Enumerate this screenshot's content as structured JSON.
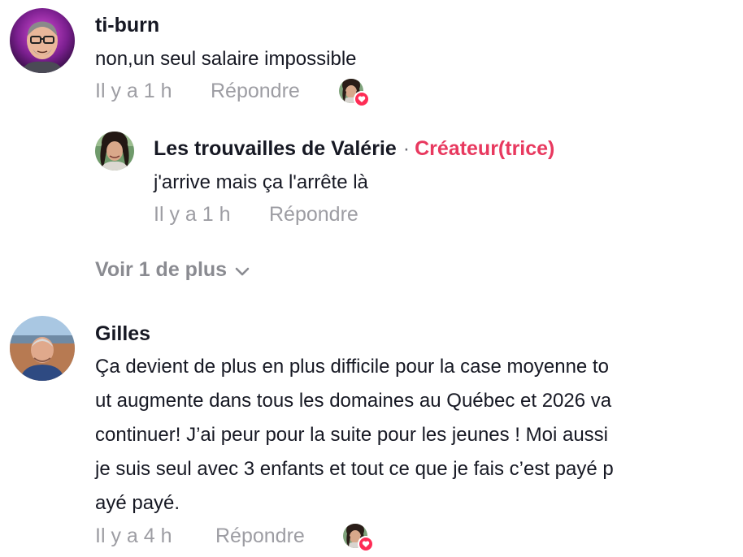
{
  "comments": [
    {
      "username": "ti-burn",
      "text": "non,un seul salaire impossible",
      "time": "Il y a 1 h",
      "reply_label": "Répondre",
      "avatar_icon": "cartoon-man-avatar",
      "creator_liked": true,
      "replies": [
        {
          "username": "Les trouvailles de Valérie",
          "separator": "·",
          "badge": "Créateur(trice)",
          "text": "j'arrive mais ça l'arrête là",
          "time": "Il y a 1 h",
          "reply_label": "Répondre",
          "avatar_icon": "woman-avatar"
        }
      ],
      "see_more_label": "Voir 1 de plus"
    },
    {
      "username": "Gilles",
      "text_lines": [
        "Ça devient de plus en plus difficile pour la case moyenne to",
        "ut augmente dans tous les domaines au Québec et 2026 va",
        "continuer! J’ai peur pour la suite pour les jeunes ! Moi aussi",
        "je suis seul avec 3 enfants et tout ce que je fais c’est payé p",
        "ayé payé."
      ],
      "time": "Il y a 4 h",
      "reply_label": "Répondre",
      "avatar_icon": "man-beach-photo-avatar",
      "creator_liked": true
    }
  ],
  "colors": {
    "text": "#161823",
    "meta": "#9d9da3",
    "creator_badge": "#e8395f",
    "like_badge": "#fe2c55"
  }
}
